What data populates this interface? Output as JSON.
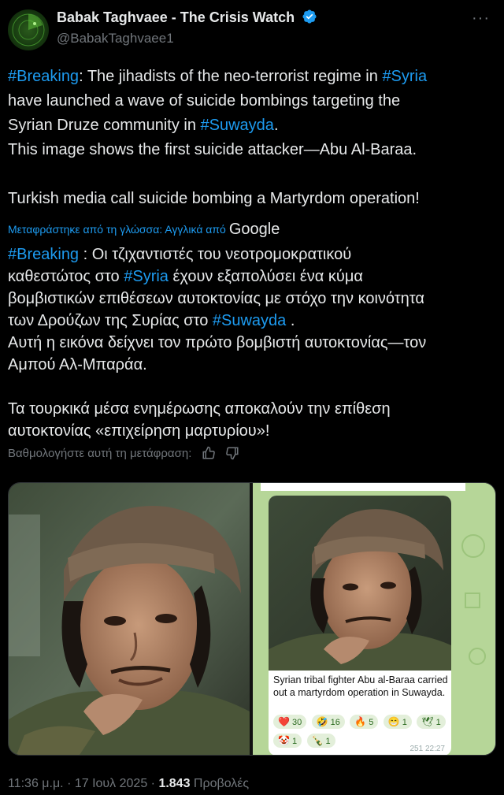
{
  "header": {
    "display_name": "Babak Taghvaee - The Crisis Watch",
    "handle": "@BabakTaghvaee1",
    "more_label": "···"
  },
  "original": {
    "line1_tag": "#Breaking",
    "line1_text": ": The jihadists of the neo-terrorist regime in ",
    "line1_tag2": "#Syria",
    "line2_text": "have launched a wave of suicide bombings targeting the",
    "line3_text": "Syrian Druze community in ",
    "line3_tag": "#Suwayda",
    "line3_end": ".",
    "line4_text": "This image shows the first suicide attacker—Abu Al-Baraa.",
    "line5_text": "Turkish media call suicide bombing a Martyrdom operation!"
  },
  "translated_by": {
    "text": "Μεταφράστηκε από τη γλώσσα: Αγγλικά από",
    "provider": "Google"
  },
  "translation": {
    "l1_tag": "#Breaking",
    "l1_text": " : Οι τζιχαντιστές του νεοτρομοκρατικού",
    "l2_text": "καθεστώτος στο ",
    "l2_tag": "#Syria",
    "l2_end": " έχουν εξαπολύσει ένα κύμα",
    "l3_text": "βομβιστικών επιθέσεων αυτοκτονίας με στόχο την κοινότητα",
    "l4_text": "των Δρούζων της Συρίας στο ",
    "l4_tag": "#Suwayda",
    "l4_end": " .",
    "l5_text": "Αυτή η εικόνα δείχνει τον πρώτο βομβιστή αυτοκτονίας—τον",
    "l6_text": "Αμπού Αλ-Μπαράα.",
    "l7_text": "Τα τουρκικά μέσα ενημέρωσης αποκαλούν την επίθεση",
    "l8_text": "αυτοκτονίας «επιχείρηση μαρτυρίου»!"
  },
  "rate": {
    "label": "Βαθμολογήστε αυτή τη μετάφραση:"
  },
  "media": {
    "caption": "Syrian tribal fighter Abu al-Baraa carried out a martyrdom operation in Suwayda.",
    "reactions": [
      {
        "emoji": "❤️",
        "count": "30"
      },
      {
        "emoji": "🤣",
        "count": "16"
      },
      {
        "emoji": "🔥",
        "count": "5"
      },
      {
        "emoji": "😁",
        "count": "1"
      },
      {
        "emoji": "🕊",
        "count": "1"
      },
      {
        "emoji": "🤡",
        "count": "1"
      },
      {
        "emoji": "🍾",
        "count": "1"
      }
    ],
    "msg_meta": "251  22:27"
  },
  "footer": {
    "time": "11:36 μ.μ. · 17 Ιουλ 2025 · ",
    "views": "1.843",
    "views_label": " Προβολές"
  },
  "colors": {
    "accent": "#1d9bf0",
    "muted": "#71767b",
    "text": "#e7e9ea",
    "background": "#000000"
  }
}
